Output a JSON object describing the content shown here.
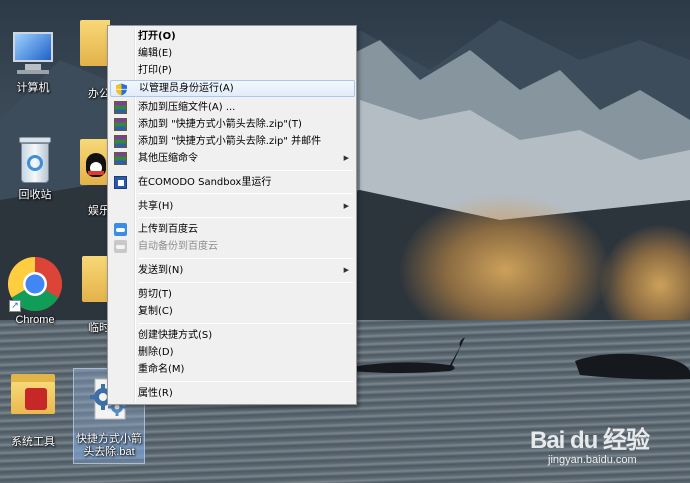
{
  "desktop": {
    "icons": [
      {
        "label": "计算机"
      },
      {
        "label": "办公"
      },
      {
        "label": "回收站"
      },
      {
        "label": "娱乐"
      },
      {
        "label": "Chrome"
      },
      {
        "label": "临时"
      },
      {
        "label": "系统工具"
      },
      {
        "label": "快捷方式小箭头去除.bat"
      }
    ]
  },
  "context_menu": {
    "items": [
      {
        "label": "打开(O)",
        "style": "bold"
      },
      {
        "label": "编辑(E)"
      },
      {
        "label": "打印(P)"
      },
      {
        "label": "以管理员身份运行(A)",
        "icon": "uac-shield-icon",
        "highlighted": true
      },
      {
        "label": "添加到压缩文件(A) ...",
        "icon": "winrar-icon"
      },
      {
        "label": "添加到 \"快捷方式小箭头去除.zip\"(T)",
        "icon": "winrar-icon"
      },
      {
        "label": "添加到 \"快捷方式小箭头去除.zip\" 并邮件",
        "icon": "winrar-icon"
      },
      {
        "label": "其他压缩命令",
        "icon": "winrar-icon",
        "submenu": true
      },
      {
        "label": "在COMODO Sandbox里运行",
        "icon": "comodo-icon"
      },
      {
        "label": "共享(H)",
        "submenu": true
      },
      {
        "label": "上传到百度云",
        "icon": "baidu-cloud-icon"
      },
      {
        "label": "自动备份到百度云",
        "icon": "baidu-cloud-icon",
        "disabled": true
      },
      {
        "label": "发送到(N)",
        "submenu": true
      },
      {
        "label": "剪切(T)"
      },
      {
        "label": "复制(C)"
      },
      {
        "label": "创建快捷方式(S)"
      },
      {
        "label": "删除(D)"
      },
      {
        "label": "重命名(M)"
      },
      {
        "label": "属性(R)"
      }
    ],
    "submenu_arrow": "▶"
  },
  "watermark": {
    "logo": "Bai du 经验",
    "url": "jingyan.baidu.com"
  },
  "colors": {
    "menu_bg": "#f0f0f0",
    "highlight_border": "#a8c8ec",
    "disabled_text": "#8d8d8d"
  }
}
